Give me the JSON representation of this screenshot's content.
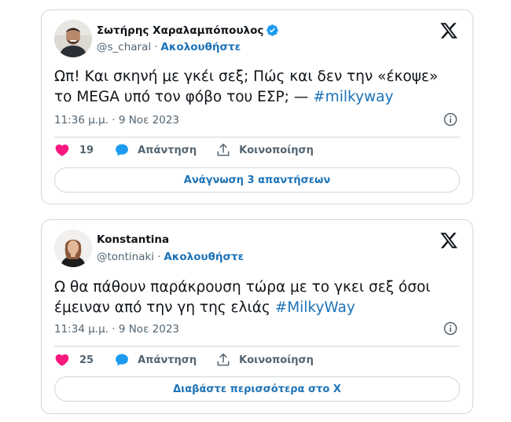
{
  "tweets": [
    {
      "author_name": "Σωτήρης Χαραλαμπόπουλος",
      "verified": true,
      "handle": "@s_charal",
      "separator": "·",
      "follow_label": "Ακολουθήστε",
      "text": "Ωπ! Και σκηνή με γκέι σεξ; Πώς και δεν την «έκοψε» το MEGA υπό τον φόβο του ΕΣΡ; — ",
      "hashtag": "#milkyway",
      "timestamp": "11:36 μ.μ. · 9 Νοε 2023",
      "like_count": "19",
      "reply_label": "Απάντηση",
      "share_label": "Κοινοποίηση",
      "bottom_button_label": "Ανάγνωση 3 απαντήσεων"
    },
    {
      "author_name": "Konstantina",
      "verified": false,
      "handle": "@tontinaki",
      "separator": "·",
      "follow_label": "Ακολουθήστε",
      "text": "Ω θα πάθουν παράκρουση τώρα με το γκει σεξ όσοι έμειναν από την γη της ελιάς  ",
      "hashtag": "#MilkyWay",
      "timestamp": "11:34 μ.μ. · 9 Νοε 2023",
      "like_count": "25",
      "reply_label": "Απάντηση",
      "share_label": "Κοινοποίηση",
      "bottom_button_label": "Διαβάστε περισσότερα στο Χ"
    }
  ],
  "colors": {
    "link": "#1d73b8",
    "verified_badge": "#1d9bf0",
    "heart": "#f91880",
    "secondary_text": "#536471",
    "border": "#cfd9de"
  },
  "icons": {
    "verified": "verified-badge-icon",
    "x_logo": "x-logo-icon",
    "info": "info-icon",
    "like": "heart-icon",
    "reply": "reply-bubble-icon",
    "share": "share-upload-icon"
  }
}
